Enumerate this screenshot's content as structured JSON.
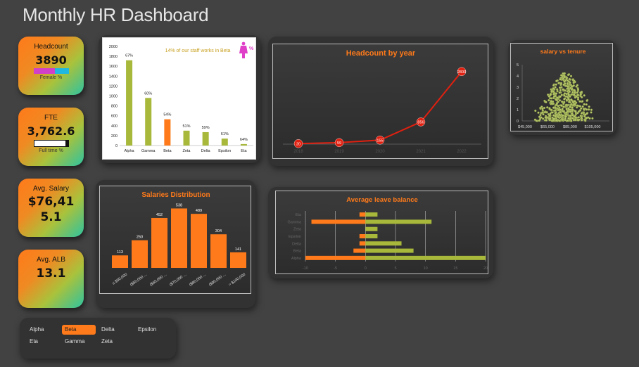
{
  "header": {
    "title": "Monthly HR Dashboard"
  },
  "kpis": {
    "headcount": {
      "label": "Headcount",
      "value": "3890",
      "sub": "Female %",
      "female_share": 0.6
    },
    "fte": {
      "label": "FTE",
      "value": "3,762.6",
      "sub": "Full time %",
      "fulltime_share": 0.92
    },
    "salary": {
      "label": "Avg. Salary",
      "value_line1": "$76,41",
      "value_line2": "5.1"
    },
    "alb": {
      "label": "Avg. ALB",
      "value": "13.1"
    }
  },
  "colors": {
    "orange": "#ff7a1a",
    "olive": "#a8b83a",
    "red": "#e02010",
    "pink": "#e040c8",
    "cyan": "#20b8e0"
  },
  "icons": {
    "female": "female-person-icon"
  },
  "chart_data": [
    {
      "id": "staff-by-dept",
      "type": "bar",
      "annotation": "14% of our staff works in Beta",
      "annotation_badge": "%",
      "categories": [
        "Alpha",
        "Gamma",
        "Beta",
        "Zeta",
        "Delta",
        "Epsilon",
        "Eta"
      ],
      "values": [
        1720,
        960,
        530,
        300,
        270,
        140,
        30
      ],
      "data_labels": [
        "67%",
        "60%",
        "54%",
        "51%",
        "59%",
        "61%",
        "64%"
      ],
      "highlight": "Beta",
      "ylim": [
        0,
        2000
      ],
      "yticks": [
        0,
        200,
        400,
        600,
        800,
        1000,
        1200,
        1400,
        1600,
        1800,
        2000
      ],
      "ytick_labels": [
        "0",
        "200",
        "400",
        "600",
        "800",
        "1000",
        "1200",
        "1400",
        "1600",
        "1800",
        "2000"
      ]
    },
    {
      "id": "headcount-by-year",
      "type": "line",
      "title": "Headcount by year",
      "x": [
        "2018",
        "2019",
        "2020",
        "2021",
        "2022"
      ],
      "values": [
        20,
        59,
        155,
        856,
        2800
      ],
      "ylim": [
        0,
        3200
      ]
    },
    {
      "id": "salary-vs-tenure",
      "type": "scatter",
      "title": "salary vs tenure",
      "xlim": [
        45000,
        115000
      ],
      "ylim": [
        0,
        5
      ],
      "xticks": [
        "$45,000",
        "$65,000",
        "$85,000",
        "$105,000"
      ],
      "yticks": [
        "0",
        "1",
        "2",
        "3",
        "4",
        "5"
      ]
    },
    {
      "id": "salary-distribution",
      "type": "bar",
      "title": "Salaries Distribution",
      "categories": [
        "≤ $50,000",
        "($50,000 ...",
        "($60,000 ...",
        "($70,000 ...",
        "($80,000 ...",
        "($90,000 ...",
        "> $100,000"
      ],
      "values": [
        113,
        250,
        452,
        538,
        489,
        304,
        141
      ],
      "ylim": [
        0,
        560
      ]
    },
    {
      "id": "leave-balance",
      "type": "bar",
      "title": "Average leave balance",
      "categories": [
        "Eta",
        "Gamma",
        "Zeta",
        "Epsilon",
        "Delta",
        "Beta",
        "Alpha"
      ],
      "series": [
        {
          "values": [
            -1,
            -9,
            0,
            -1,
            -1,
            -2,
            -10
          ]
        },
        {
          "values": [
            2,
            11,
            2,
            2,
            6,
            8,
            20
          ]
        }
      ],
      "xlim": [
        -10,
        20
      ],
      "xticks": [
        "-10",
        "-5",
        "0",
        "5",
        "10",
        "15",
        "20"
      ]
    }
  ],
  "slicer": {
    "items": [
      "Alpha",
      "Beta",
      "Delta",
      "Epsilon",
      "Eta",
      "Gamma",
      "Zeta"
    ],
    "selected": "Beta"
  }
}
